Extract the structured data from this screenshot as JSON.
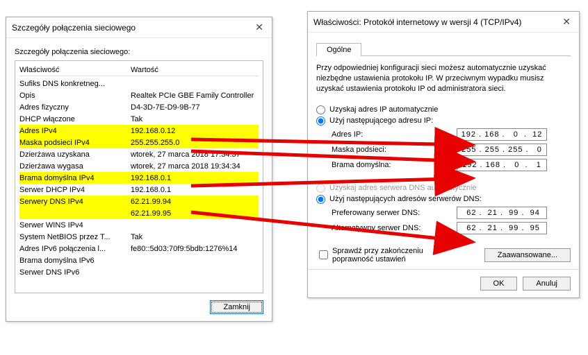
{
  "left": {
    "title": "Szczegóły połączenia sieciowego",
    "caption": "Szczegóły połączenia sieciowego:",
    "cols": {
      "prop": "Właściwość",
      "val": "Wartość"
    },
    "rows": [
      {
        "p": "Sufiks DNS konkretneg...",
        "v": "",
        "hl": false
      },
      {
        "p": "Opis",
        "v": "Realtek PCIe GBE Family Controller",
        "hl": false
      },
      {
        "p": "Adres fizyczny",
        "v": "D4-3D-7E-D9-9B-77",
        "hl": false
      },
      {
        "p": "DHCP włączone",
        "v": "Tak",
        "hl": false
      },
      {
        "p": "Adres IPv4",
        "v": "192.168.0.12",
        "hl": true
      },
      {
        "p": "Maska podsieci IPv4",
        "v": "255.255.255.0",
        "hl": true
      },
      {
        "p": "Dzierżawa uzyskana",
        "v": "wtorek, 27 marca 2018 17:34:37",
        "hl": false
      },
      {
        "p": "Dzierżawa wygasa",
        "v": "wtorek, 27 marca 2018 19:34:34",
        "hl": false
      },
      {
        "p": "Brama domyślna IPv4",
        "v": "192.168.0.1",
        "hl": true
      },
      {
        "p": "Serwer DHCP IPv4",
        "v": "192.168.0.1",
        "hl": false
      },
      {
        "p": "Serwery DNS IPv4",
        "v": "62.21.99.94",
        "hl": true
      },
      {
        "p": "",
        "v": "62.21.99.95",
        "hl": true
      },
      {
        "p": "Serwer WINS IPv4",
        "v": "",
        "hl": false
      },
      {
        "p": "System NetBIOS przez T...",
        "v": "Tak",
        "hl": false
      },
      {
        "p": "Adres IPv6 połączenia l...",
        "v": "fe80::5d03:70f9:5bdb:1276%14",
        "hl": false
      },
      {
        "p": "Brama domyślna IPv6",
        "v": "",
        "hl": false
      },
      {
        "p": "Serwer DNS IPv6",
        "v": "",
        "hl": false
      }
    ],
    "closeBtn": "Zamknij"
  },
  "right": {
    "title": "Właściwości: Protokół internetowy w wersji 4 (TCP/IPv4)",
    "tab": "Ogólne",
    "desc": "Przy odpowiedniej konfiguracji sieci możesz automatycznie uzyskać niezbędne ustawienia protokołu IP. W przeciwnym wypadku musisz uzyskać ustawienia protokołu IP od administratora sieci.",
    "ip": {
      "autoLabel": "Uzyskaj adres IP automatycznie",
      "manualLabel": "Użyj następującego adresu IP:",
      "addr": {
        "label": "Adres IP:",
        "val": "192 . 168 .   0  .  12"
      },
      "mask": {
        "label": "Maska podsieci:",
        "val": "255 . 255 . 255 .   0"
      },
      "gate": {
        "label": "Brama domyślna:",
        "val": "192 . 168 .   0  .   1"
      }
    },
    "dns": {
      "autoLabel": "Uzyskaj adres serwera DNS automatycznie",
      "manualLabel": "Użyj następujących adresów serwerów DNS:",
      "pref": {
        "label": "Preferowany serwer DNS:",
        "val": " 62 .  21 .  99 .  94"
      },
      "alt": {
        "label": "Alternatywny serwer DNS:",
        "val": " 62 .  21 .  99 .  95"
      }
    },
    "validate": "Sprawdź przy zakończeniu poprawność ustawień",
    "adv": "Zaawansowane...",
    "ok": "OK",
    "cancel": "Anuluj"
  }
}
